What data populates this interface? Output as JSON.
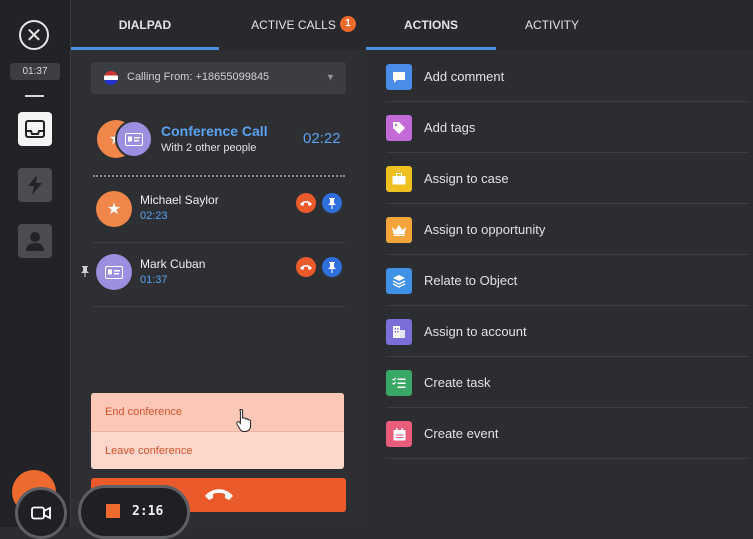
{
  "rail": {
    "timer": "01:37"
  },
  "center": {
    "tabs": [
      {
        "label": "DIALPAD"
      },
      {
        "label": "ACTIVE CALLS",
        "badge": "1"
      }
    ],
    "calling_from": "Calling From: +18655099845",
    "conference": {
      "title": "Conference Call",
      "subtitle": "With 2 other people",
      "time": "02:22"
    },
    "participants": [
      {
        "name": "Michael Saylor",
        "time": "02:23"
      },
      {
        "name": "Mark Cuban",
        "time": "01:37"
      }
    ],
    "menu": [
      {
        "label": "End conference"
      },
      {
        "label": "Leave conference"
      }
    ]
  },
  "recording": {
    "time": "2:16"
  },
  "right": {
    "tabs": [
      {
        "label": "ACTIONS"
      },
      {
        "label": "ACTIVITY"
      }
    ],
    "actions": [
      {
        "label": "Add comment",
        "color": "#4a8de8",
        "icon": "comment-icon"
      },
      {
        "label": "Add tags",
        "color": "#c46ad8",
        "icon": "tag-icon"
      },
      {
        "label": "Assign to case",
        "color": "#f0c020",
        "icon": "briefcase-icon"
      },
      {
        "label": "Assign to opportunity",
        "color": "#f3a43a",
        "icon": "crown-icon"
      },
      {
        "label": "Relate to Object",
        "color": "#3f92e6",
        "icon": "layers-icon"
      },
      {
        "label": "Assign to account",
        "color": "#7a6fd8",
        "icon": "building-icon"
      },
      {
        "label": "Create task",
        "color": "#3aa865",
        "icon": "checklist-icon"
      },
      {
        "label": "Create event",
        "color": "#e95c7a",
        "icon": "calendar-icon"
      }
    ]
  }
}
